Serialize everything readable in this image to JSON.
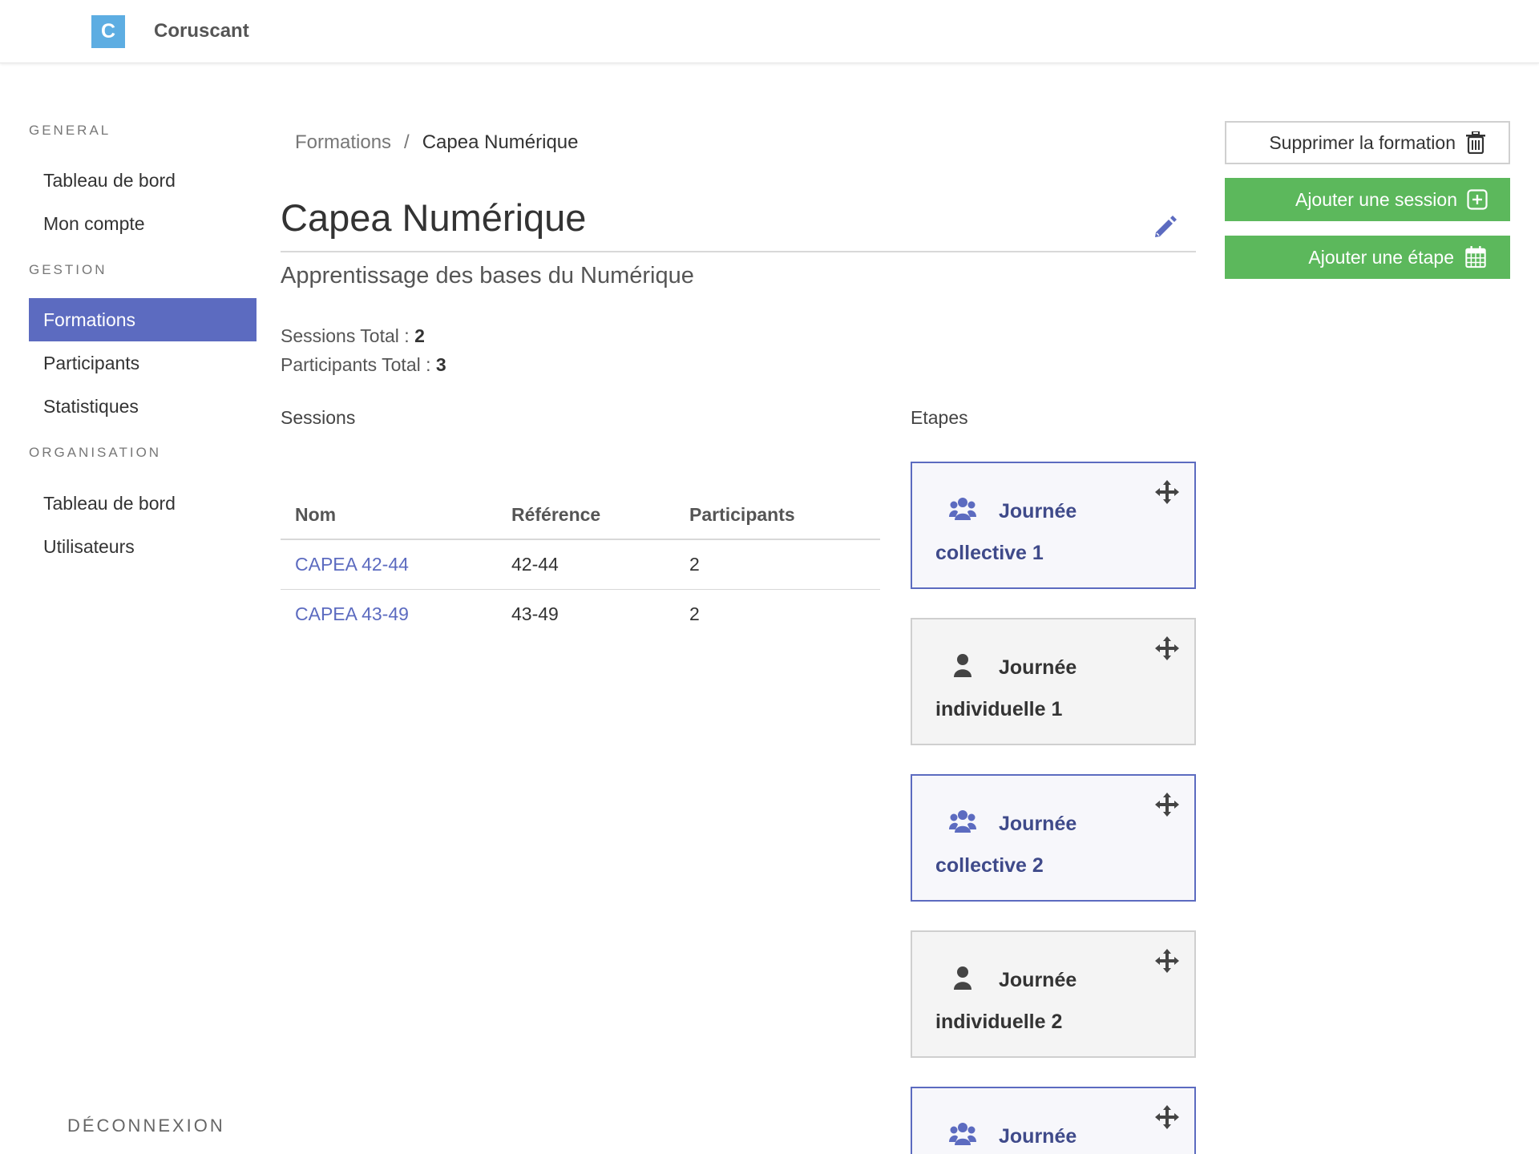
{
  "app": {
    "logo_letter": "C",
    "name": "Coruscant"
  },
  "sidebar": {
    "sections": [
      {
        "title": "GENERAL",
        "items": [
          {
            "label": "Tableau de bord"
          },
          {
            "label": "Mon compte"
          }
        ]
      },
      {
        "title": "GESTION",
        "items": [
          {
            "label": "Formations",
            "active": true
          },
          {
            "label": "Participants"
          },
          {
            "label": "Statistiques"
          }
        ]
      },
      {
        "title": "ORGANISATION",
        "items": [
          {
            "label": "Tableau de bord"
          },
          {
            "label": "Utilisateurs"
          }
        ]
      }
    ],
    "logout_label": "DÉCONNEXION",
    "active_color": "#5c6bc0"
  },
  "breadcrumb": {
    "parent": "Formations",
    "separator": "/",
    "current": "Capea Numérique"
  },
  "formation": {
    "title": "Capea Numérique",
    "subtitle": "Apprentissage des bases du Numérique",
    "sessions_total_label": "Sessions Total : ",
    "sessions_total_value": "2",
    "participants_total_label": "Participants Total : ",
    "participants_total_value": "3"
  },
  "sessions": {
    "title": "Sessions",
    "columns": [
      "Nom",
      "Référence",
      "Participants"
    ],
    "rows": [
      {
        "nom": "CAPEA 42-44",
        "reference": "42-44",
        "participants": "2"
      },
      {
        "nom": "CAPEA 43-49",
        "reference": "43-49",
        "participants": "2"
      }
    ]
  },
  "etapes": {
    "title": "Etapes",
    "items": [
      {
        "type": "collective",
        "icon": "users-icon",
        "line1": "Journée",
        "line2": "collective 1"
      },
      {
        "type": "individual",
        "icon": "user-icon",
        "line1": "Journée",
        "line2": "individuelle 1"
      },
      {
        "type": "collective",
        "icon": "users-icon",
        "line1": "Journée",
        "line2": "collective 2"
      },
      {
        "type": "individual",
        "icon": "user-icon",
        "line1": "Journée",
        "line2": "individuelle 2"
      },
      {
        "type": "collective",
        "icon": "users-icon",
        "line1": "Journée",
        "line2": ""
      }
    ]
  },
  "actions": {
    "delete_label": "Supprimer la formation",
    "add_session_label": "Ajouter une session",
    "add_step_label": "Ajouter une étape",
    "green_color": "#5cb85c"
  }
}
